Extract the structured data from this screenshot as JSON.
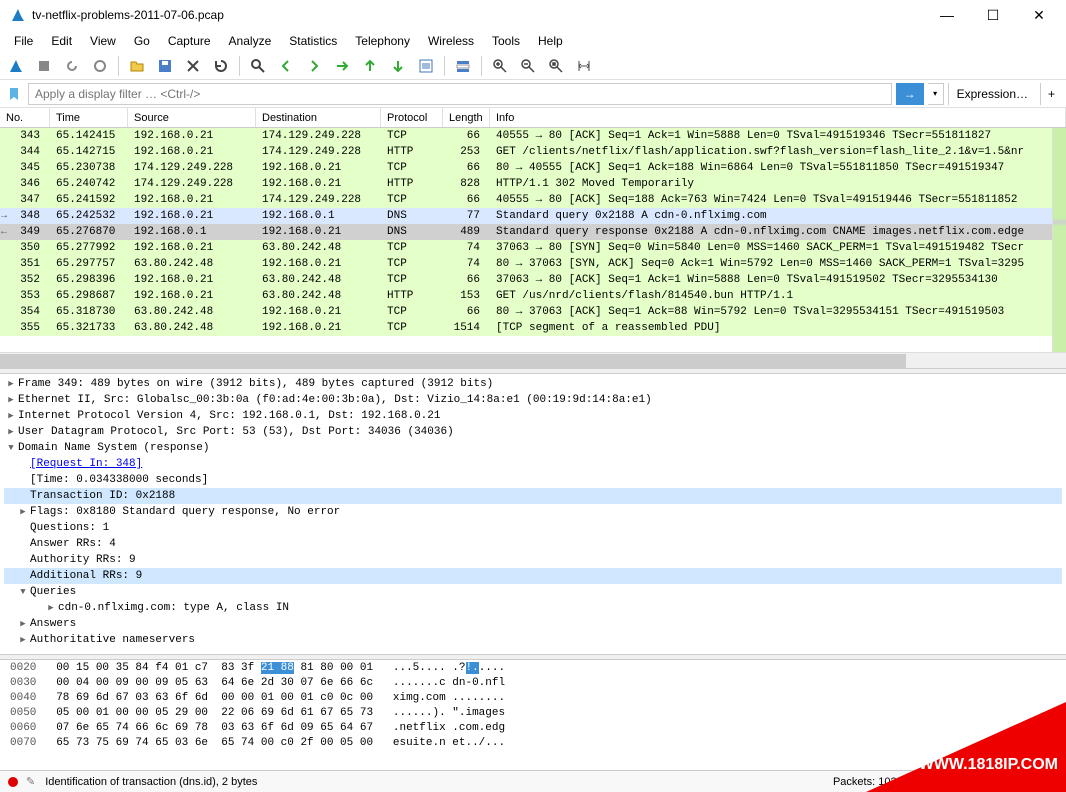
{
  "window": {
    "title": "tv-netflix-problems-2011-07-06.pcap"
  },
  "menu": [
    "File",
    "Edit",
    "View",
    "Go",
    "Capture",
    "Analyze",
    "Statistics",
    "Telephony",
    "Wireless",
    "Tools",
    "Help"
  ],
  "filter": {
    "placeholder": "Apply a display filter … <Ctrl-/>",
    "expression_label": "Expression…"
  },
  "columns": {
    "no": "No.",
    "time": "Time",
    "source": "Source",
    "destination": "Destination",
    "protocol": "Protocol",
    "length": "Length",
    "info": "Info"
  },
  "packets": [
    {
      "no": "343",
      "time": "65.142415",
      "src": "192.168.0.21",
      "dst": "174.129.249.228",
      "proto": "TCP",
      "len": "66",
      "info": "40555 → 80 [ACK] Seq=1 Ack=1 Win=5888 Len=0 TSval=491519346 TSecr=551811827",
      "cls": "green"
    },
    {
      "no": "344",
      "time": "65.142715",
      "src": "192.168.0.21",
      "dst": "174.129.249.228",
      "proto": "HTTP",
      "len": "253",
      "info": "GET /clients/netflix/flash/application.swf?flash_version=flash_lite_2.1&v=1.5&nr",
      "cls": "green"
    },
    {
      "no": "345",
      "time": "65.230738",
      "src": "174.129.249.228",
      "dst": "192.168.0.21",
      "proto": "TCP",
      "len": "66",
      "info": "80 → 40555 [ACK] Seq=1 Ack=188 Win=6864 Len=0 TSval=551811850 TSecr=491519347",
      "cls": "green"
    },
    {
      "no": "346",
      "time": "65.240742",
      "src": "174.129.249.228",
      "dst": "192.168.0.21",
      "proto": "HTTP",
      "len": "828",
      "info": "HTTP/1.1 302 Moved Temporarily",
      "cls": "green"
    },
    {
      "no": "347",
      "time": "65.241592",
      "src": "192.168.0.21",
      "dst": "174.129.249.228",
      "proto": "TCP",
      "len": "66",
      "info": "40555 → 80 [ACK] Seq=188 Ack=763 Win=7424 Len=0 TSval=491519446 TSecr=551811852",
      "cls": "green"
    },
    {
      "no": "348",
      "time": "65.242532",
      "src": "192.168.0.21",
      "dst": "192.168.0.1",
      "proto": "DNS",
      "len": "77",
      "info": "Standard query 0x2188 A cdn-0.nflximg.com",
      "cls": "blue",
      "mark": "→"
    },
    {
      "no": "349",
      "time": "65.276870",
      "src": "192.168.0.1",
      "dst": "192.168.0.21",
      "proto": "DNS",
      "len": "489",
      "info": "Standard query response 0x2188 A cdn-0.nflximg.com CNAME images.netflix.com.edge",
      "cls": "sel",
      "mark": "←"
    },
    {
      "no": "350",
      "time": "65.277992",
      "src": "192.168.0.21",
      "dst": "63.80.242.48",
      "proto": "TCP",
      "len": "74",
      "info": "37063 → 80 [SYN] Seq=0 Win=5840 Len=0 MSS=1460 SACK_PERM=1 TSval=491519482 TSecr",
      "cls": "green"
    },
    {
      "no": "351",
      "time": "65.297757",
      "src": "63.80.242.48",
      "dst": "192.168.0.21",
      "proto": "TCP",
      "len": "74",
      "info": "80 → 37063 [SYN, ACK] Seq=0 Ack=1 Win=5792 Len=0 MSS=1460 SACK_PERM=1 TSval=3295",
      "cls": "green"
    },
    {
      "no": "352",
      "time": "65.298396",
      "src": "192.168.0.21",
      "dst": "63.80.242.48",
      "proto": "TCP",
      "len": "66",
      "info": "37063 → 80 [ACK] Seq=1 Ack=1 Win=5888 Len=0 TSval=491519502 TSecr=3295534130",
      "cls": "green"
    },
    {
      "no": "353",
      "time": "65.298687",
      "src": "192.168.0.21",
      "dst": "63.80.242.48",
      "proto": "HTTP",
      "len": "153",
      "info": "GET /us/nrd/clients/flash/814540.bun HTTP/1.1",
      "cls": "green"
    },
    {
      "no": "354",
      "time": "65.318730",
      "src": "63.80.242.48",
      "dst": "192.168.0.21",
      "proto": "TCP",
      "len": "66",
      "info": "80 → 37063 [ACK] Seq=1 Ack=88 Win=5792 Len=0 TSval=3295534151 TSecr=491519503",
      "cls": "green"
    },
    {
      "no": "355",
      "time": "65.321733",
      "src": "63.80.242.48",
      "dst": "192.168.0.21",
      "proto": "TCP",
      "len": "1514",
      "info": "[TCP segment of a reassembled PDU]",
      "cls": "green"
    }
  ],
  "details": {
    "frame": "Frame 349: 489 bytes on wire (3912 bits), 489 bytes captured (3912 bits)",
    "eth": "Ethernet II, Src: Globalsc_00:3b:0a (f0:ad:4e:00:3b:0a), Dst: Vizio_14:8a:e1 (00:19:9d:14:8a:e1)",
    "ip": "Internet Protocol Version 4, Src: 192.168.0.1, Dst: 192.168.0.21",
    "udp": "User Datagram Protocol, Src Port: 53 (53), Dst Port: 34036 (34036)",
    "dns": "Domain Name System (response)",
    "request_in": "[Request In: 348]",
    "time": "[Time: 0.034338000 seconds]",
    "transaction": "Transaction ID: 0x2188",
    "flags": "Flags: 0x8180 Standard query response, No error",
    "questions": "Questions: 1",
    "answer_rrs": "Answer RRs: 4",
    "authority_rrs": "Authority RRs: 9",
    "additional_rrs": "Additional RRs: 9",
    "queries": "Queries",
    "query1": "cdn-0.nflximg.com: type A, class IN",
    "answers": "Answers",
    "authns": "Authoritative nameservers"
  },
  "hex": [
    {
      "off": "0020",
      "b": "00 15 00 35 84 f4 01 c7  83 3f ",
      "sel": "21 88",
      "b2": " 81 80 00 01",
      "a": "   ...5.... .?",
      "asel": "!.",
      "a2": "...."
    },
    {
      "off": "0030",
      "b": "00 04 00 09 00 09 05 63  64 6e 2d 30 07 6e 66 6c",
      "a": "   .......c dn-0.nfl"
    },
    {
      "off": "0040",
      "b": "78 69 6d 67 03 63 6f 6d  00 00 01 00 01 c0 0c 00",
      "a": "   ximg.com ........"
    },
    {
      "off": "0050",
      "b": "05 00 01 00 00 05 29 00  22 06 69 6d 61 67 65 73",
      "a": "   ......). \".images"
    },
    {
      "off": "0060",
      "b": "07 6e 65 74 66 6c 69 78  03 63 6f 6d 09 65 64 67",
      "a": "   .netflix .com.edg"
    },
    {
      "off": "0070",
      "b": "65 73 75 69 74 65 03 6e  65 74 00 c0 2f 00 05 00",
      "a": "   esuite.n et../..."
    }
  ],
  "status": {
    "left": "Identification of transaction (dns.id), 2 bytes",
    "right": "Packets: 10299 · Displayed: 10299 (100.0%) · "
  },
  "watermark": "WWW.1818IP.COM"
}
